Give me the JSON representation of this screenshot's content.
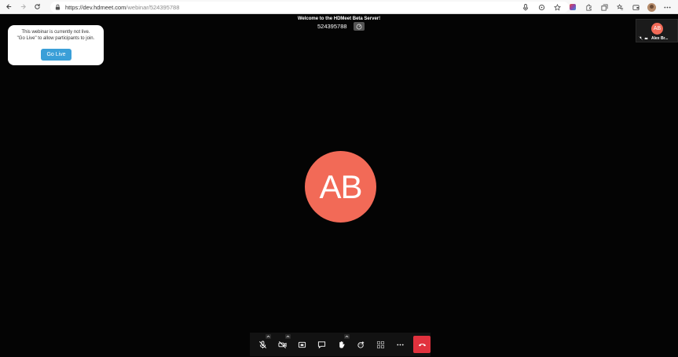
{
  "browser": {
    "url_host": "https://dev.hdmeet.com",
    "url_path": "/webinar/524395788",
    "back_icon": "arrow-left-icon",
    "forward_icon": "arrow-right-icon",
    "reload_icon": "reload-icon"
  },
  "meeting": {
    "welcome_text": "Welcome to the HDMeet Beta Server!",
    "meeting_id": "524395788"
  },
  "notice": {
    "line1": "This webinar is currently not live.",
    "line2": "\"Go Live\" to allow participants to join.",
    "go_live_label": "Go Live"
  },
  "main_participant": {
    "initials": "AB",
    "avatar_color": "#f26a57"
  },
  "thumbnail": {
    "initials": "AB",
    "name": "Alex Br..."
  },
  "controls": {
    "items": [
      "mic-muted-icon",
      "camera-off-icon",
      "screen-share-icon",
      "chat-icon",
      "raise-hand-icon",
      "reactions-icon",
      "tile-view-icon",
      "more-icon",
      "hangup-icon"
    ],
    "hangup_color": "#e1323e"
  },
  "colors": {
    "go_live": "#3a9fd8",
    "stage": "#040404"
  }
}
